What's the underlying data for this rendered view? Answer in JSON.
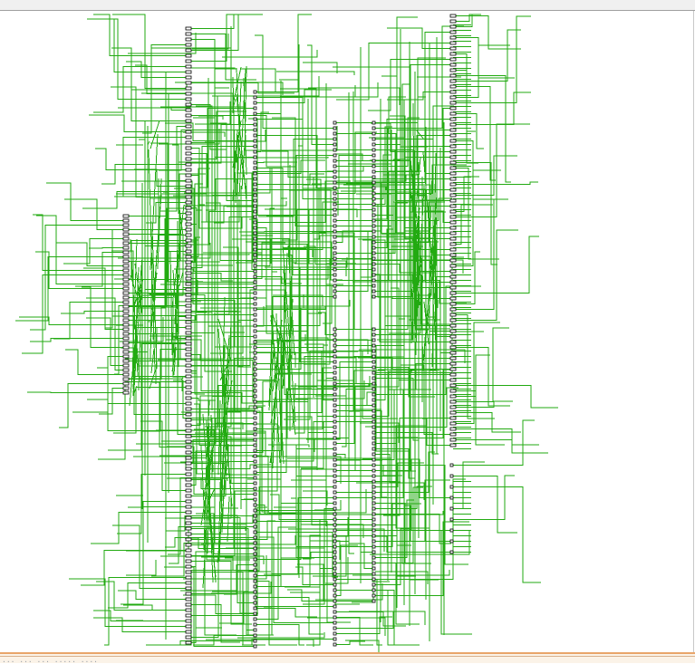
{
  "window": {
    "status_text": "... ... ... ..... ...."
  },
  "theme": {
    "wire_color": "#22aa11",
    "cell_color": "#000000",
    "background": "#ffffff",
    "frame_accent": "#e9a56a"
  },
  "schematic": {
    "description_icon": "netlist-schematic-icon"
  }
}
